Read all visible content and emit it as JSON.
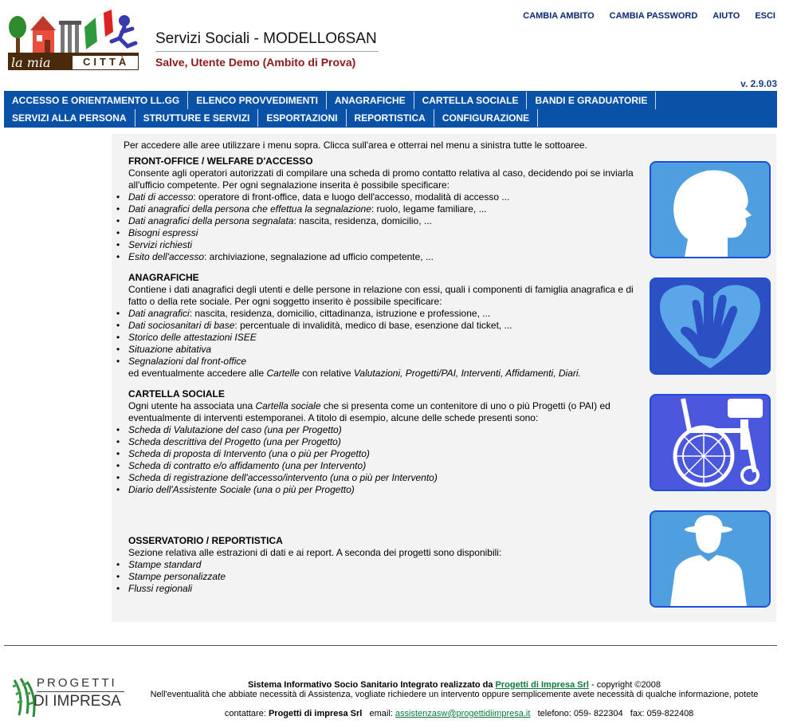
{
  "header": {
    "logo_text_left": "la mia",
    "logo_text_right": "CITTÀ",
    "app_title": "Servizi Sociali - MODELLO6SAN",
    "greeting": "Salve,  Utente Demo (Ambito di Prova)",
    "version": "v. 2.9.03",
    "links": [
      "CAMBIA AMBITO",
      "CAMBIA PASSWORD",
      "AIUTO",
      "ESCI"
    ]
  },
  "nav": {
    "row1": [
      "ACCESSO E ORIENTAMENTO LL.GG",
      "ELENCO PROVVEDIMENTI",
      "ANAGRAFICHE",
      "CARTELLA SOCIALE",
      "BANDI E GRADUATORIE"
    ],
    "row2": [
      "SERVIZI ALLA PERSONA",
      "STRUTTURE E SERVIZI",
      "ESPORTAZIONI",
      "REPORTISTICA",
      "CONFIGURAZIONE"
    ]
  },
  "intro": "Per accedere alle aree utilizzare i menu sopra. Clicca sull'area e otterrai nel menu a sinistra tutte le sottoaree.",
  "sections": {
    "front_office": {
      "title": "FRONT-OFFICE / WELFARE D'ACCESSO",
      "desc": "Consente agli operatori autorizzati di compilare una scheda di promo contatto relativa al caso, decidendo poi se inviarla all'ufficio competente. Per ogni segnalazione inserita è possibile specificare:",
      "items": [
        {
          "em": "Dati di accesso",
          "rest": ": operatore di front-office, data e luogo dell'accesso, modalità di accesso ..."
        },
        {
          "em": "Dati anagrafici della persona che effettua la segnalazione",
          "rest": ": ruolo, legame familiare, ..."
        },
        {
          "em": "Dati anagrafici della persona segnalata",
          "rest": ": nascita, residenza, domicilio, ..."
        },
        {
          "em": "Bisogni espressi",
          "rest": ""
        },
        {
          "em": "Servizi richiesti",
          "rest": ""
        },
        {
          "em": "Esito dell'accesso",
          "rest": ": archiviazione, segnalazione ad ufficio competente, ..."
        }
      ]
    },
    "anagrafiche": {
      "title": "ANAGRAFICHE",
      "desc": "Contiene i dati anagrafici degli utenti e delle persone in relazione con essi, quali i componenti di famiglia anagrafica e di fatto o della rete sociale. Per ogni soggetto inserito è possibile specificare:",
      "items": [
        {
          "em": "Dati anagrafici",
          "rest": ": nascita, residenza, domicilio, cittadinanza, istruzione e professione, ..."
        },
        {
          "em": "Dati sociosanitari di base",
          "rest": ": percentuale di invalidità, medico di base, esenzione dal ticket, ..."
        },
        {
          "em": "Storico delle attestazioni ISEE",
          "rest": ""
        },
        {
          "em": "Situazione abitativa",
          "rest": ""
        },
        {
          "em": "Segnalazioni dal front-office",
          "rest": ""
        }
      ],
      "tail_prefix": "ed eventualmente accedere alle ",
      "tail_em1": "Cartelle",
      "tail_mid": " con relative ",
      "tail_em2": "Valutazioni, Progetti/PAI, Interventi, Affidamenti, Diari."
    },
    "cartella": {
      "title": "CARTELLA SOCIALE",
      "desc_prefix": "Ogni utente ha associata una ",
      "desc_em": "Cartella sociale",
      "desc_suffix": " che si presenta come un contenitore di uno o più Progetti (o PAI) ed eventualmente di interventi estemporanei. A titolo di esempio, alcune delle schede presenti sono:",
      "items": [
        {
          "em": "Scheda di Valutazione del caso (una per Progetto)",
          "rest": ""
        },
        {
          "em": "Scheda descrittiva del Progetto (una per Progetto)",
          "rest": ""
        },
        {
          "em": "Scheda di proposta di Intervento (una o più per Progetto)",
          "rest": ""
        },
        {
          "em": "Scheda di contratto e/o affidamento (una per Intervento)",
          "rest": ""
        },
        {
          "em": "Scheda di registrazione dell'accesso/intervento (una o più per Intervento)",
          "rest": ""
        },
        {
          "em": "Diario dell'Assistente Sociale (una o più per Progetto)",
          "rest": ""
        }
      ]
    },
    "osservatorio": {
      "title": "OSSERVATORIO / REPORTISTICA",
      "desc": "Sezione relativa alle estrazioni di dati e ai report. A seconda dei progetti sono disponibili:",
      "items": [
        {
          "em": "Stampe standard",
          "rest": ""
        },
        {
          "em": "Stampe personalizzate",
          "rest": ""
        },
        {
          "em": "Flussi regionali",
          "rest": ""
        }
      ]
    }
  },
  "footer": {
    "logo_line1": "PROGETTI",
    "logo_line2": "DI IMPRESA",
    "line1_prefix": "Sistema Informativo Socio Sanitario Integrato realizzato da ",
    "line1_link": "Progetti di Impresa Srl",
    "line1_suffix": " - copyright ©2008",
    "line2": "Nell'eventualità che abbiate necessità di Assistenza, vogliate richiedere un intervento oppure semplicemente avete necessità di qualche informazione, potete",
    "line3_prefix": "contattare: ",
    "line3_company": "Progetti di impresa Srl",
    "line3_email_label": "   email: ",
    "line3_email": "assistenzasw@progettidiimpresa.it",
    "line3_suffix": "   telefono: 059- 822304   fax: 059-822408"
  },
  "colors": {
    "nav_bg": "#0a52a8",
    "greeting": "#8b1a1a",
    "toplinks": "#0a2a6e",
    "card_blue": "#1c4fd6",
    "footer_link": "#0a7a3a"
  },
  "icons": [
    "child-profile-icon",
    "hand-heart-icon",
    "wheelchair-icon",
    "man-hat-icon"
  ]
}
